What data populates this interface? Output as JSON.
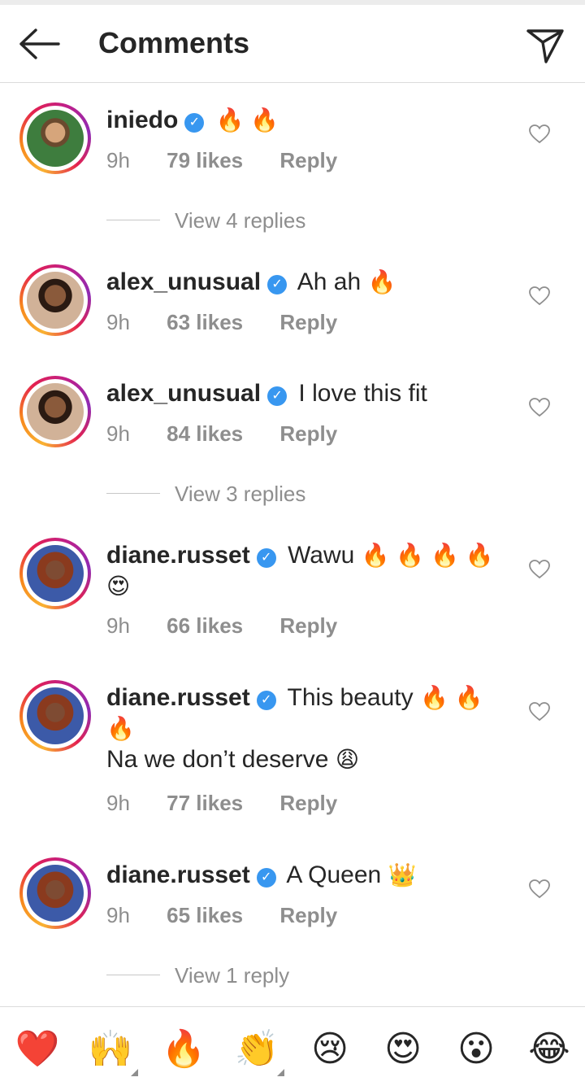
{
  "header": {
    "title": "Comments"
  },
  "comments": [
    {
      "username": "iniedo",
      "text": "",
      "emoji": "🔥 🔥",
      "time": "9h",
      "likes": "79 likes",
      "reply": "Reply"
    },
    {
      "username": "alex_unusual",
      "text": "Ah ah",
      "emoji": "🔥",
      "time": "9h",
      "likes": "63 likes",
      "reply": "Reply"
    },
    {
      "username": "alex_unusual",
      "text": "I love this fit",
      "emoji": "",
      "time": "9h",
      "likes": "84 likes",
      "reply": "Reply"
    },
    {
      "username": "diane.russet",
      "text": "Wawu",
      "emoji": "🔥 🔥 🔥 🔥",
      "emoji2": "😍",
      "time": "9h",
      "likes": "66 likes",
      "reply": "Reply"
    },
    {
      "username": "diane.russet",
      "text": "This beauty",
      "emoji": "🔥 🔥",
      "emoji2": "🔥",
      "line2": "Na we don’t deserve",
      "emoji3": "😩",
      "time": "9h",
      "likes": "77 likes",
      "reply": "Reply"
    },
    {
      "username": "diane.russet",
      "text": "A Queen",
      "emoji": "👑",
      "time": "9h",
      "likes": "65 likes",
      "reply": "Reply"
    }
  ],
  "view_replies": [
    "View 4 replies",
    "View 3 replies",
    "View 1 reply"
  ],
  "quick_emojis": [
    "❤️",
    "🙌",
    "🔥",
    "👏",
    "😢",
    "😍",
    "😮",
    "😂"
  ],
  "colors": {
    "verified": "#3897f0",
    "meta_text": "#8e8e8e",
    "text": "#262626"
  }
}
